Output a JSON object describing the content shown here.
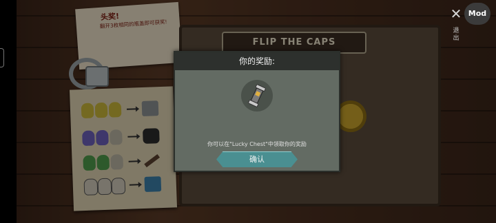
{
  "note": {
    "title": "头奖!",
    "text": "翻开3枚相同的瓶盖即可获奖!"
  },
  "board": {
    "banner": "FLIP THE CAPS"
  },
  "top_right": {
    "mod_label": "Mod",
    "side_label": "退出"
  },
  "dialog": {
    "title": "你的奖励:",
    "message": "你可以在\"Lucky Chest\"中领取你的奖励",
    "confirm_label": "确认",
    "reward_icon": "hourglass-icon"
  },
  "colors": {
    "dialog_bg": "#636b63",
    "dialog_header": "#2d302d",
    "confirm_button": "#4a8f91"
  }
}
